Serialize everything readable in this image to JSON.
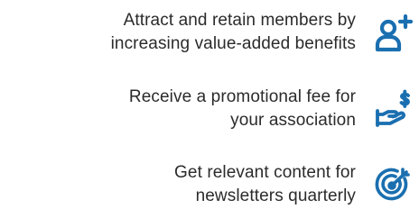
{
  "accent_color": "#1a6fb0",
  "benefits": [
    {
      "lines": [
        "Attract and retain members by",
        "increasing value-added benefits"
      ],
      "icon": "add-user-icon"
    },
    {
      "lines": [
        "Receive a promotional fee for",
        "your association"
      ],
      "icon": "hand-dollar-icon"
    },
    {
      "lines": [
        "Get relevant content for",
        "newsletters quarterly"
      ],
      "icon": "target-icon"
    }
  ]
}
